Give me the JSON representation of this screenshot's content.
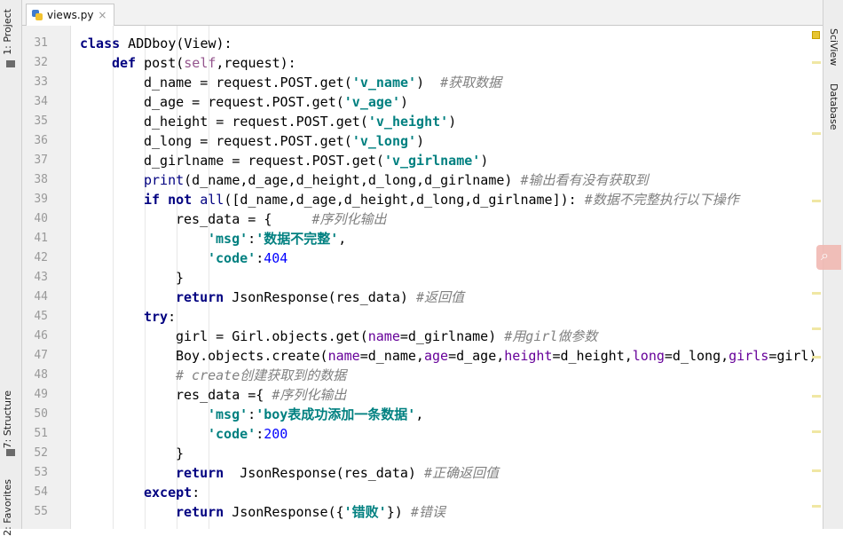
{
  "left_panel": {
    "project_tab": "1: Project",
    "structure_tab": "7: Structure",
    "favorites_tab": "2: Favorites"
  },
  "right_panel": {
    "sciview_tab": "SciView",
    "database_tab": "Database"
  },
  "editor_tab": {
    "filename": "views.py",
    "close_glyph": "×"
  },
  "line_numbers": [
    "31",
    "32",
    "33",
    "34",
    "35",
    "36",
    "37",
    "38",
    "39",
    "40",
    "41",
    "42",
    "43",
    "44",
    "45",
    "46",
    "47",
    "48",
    "49",
    "50",
    "51",
    "52",
    "53",
    "54",
    "55"
  ],
  "code": {
    "l31": {
      "kw": "class",
      "rest": " ADDboy(View):"
    },
    "l32": {
      "kw": "def",
      "a": " post(",
      "self": "self",
      "b": ",request):"
    },
    "l33": {
      "a": "d_name = request.POST.get(",
      "s": "'v_name'",
      "b": ")  ",
      "c": "#获取数据"
    },
    "l34": {
      "a": "d_age = request.POST.get(",
      "s": "'v_age'",
      "b": ")"
    },
    "l35": {
      "a": "d_height = request.POST.get(",
      "s": "'v_height'",
      "b": ")"
    },
    "l36": {
      "a": "d_long = request.POST.get(",
      "s": "'v_long'",
      "b": ")"
    },
    "l37": {
      "a": "d_girlname = request.POST.get(",
      "s": "'v_girlname'",
      "b": ")"
    },
    "l38": {
      "fn": "print",
      "a": "(d_name,d_age,d_height,d_long,d_girlname) ",
      "c": "#输出看有没有获取到"
    },
    "l39": {
      "kw1": "if",
      "kw2": "not",
      "fn": "all",
      "a": "([d_name,d_age,d_height,d_long,d_girlname]): ",
      "c": "#数据不完整执行以下操作"
    },
    "l40": {
      "a": "res_data = {     ",
      "c": "#序列化输出"
    },
    "l41": {
      "s1": "'msg'",
      "a": ":",
      "s2": "'数据不完整'",
      "b": ","
    },
    "l42": {
      "s1": "'code'",
      "a": ":",
      "n": "404"
    },
    "l43": {
      "a": "}"
    },
    "l44": {
      "kw": "return",
      "a": " JsonResponse(res_data) ",
      "c": "#返回值"
    },
    "l45": {
      "kw": "try",
      "a": ":"
    },
    "l46": {
      "a": "girl = Girl.objects.get(",
      "k": "name",
      "b": "=d_girlname) ",
      "c": "#用girl做参数"
    },
    "l47": {
      "a": "Boy.objects.create(",
      "k1": "name",
      "b": "=d_name,",
      "k2": "age",
      "c1": "=d_age,",
      "k3": "height",
      "d": "=d_height,",
      "k4": "long",
      "e": "=d_long,",
      "k5": "girls",
      "f": "=girl)"
    },
    "l48": {
      "c": "# create创建获取到的数据"
    },
    "l49": {
      "a": "res_data ={ ",
      "c": "#序列化输出"
    },
    "l50": {
      "s1": "'msg'",
      "a": ":",
      "s2": "'boy表成功添加一条数据'",
      "b": ","
    },
    "l51": {
      "s1": "'code'",
      "a": ":",
      "n": "200"
    },
    "l52": {
      "a": "}"
    },
    "l53": {
      "kw": "return",
      "a": "  JsonResponse(res_data) ",
      "c": "#正确返回值"
    },
    "l54": {
      "kw": "except",
      "a": ":"
    },
    "l55": {
      "kw": "return",
      "a": " JsonResponse({",
      "s": "'错败'",
      "b": "}) ",
      "c": "#错误"
    }
  },
  "colors": {
    "keyword": "#000080",
    "string": "#008080",
    "number": "#0000ff",
    "comment": "#808080",
    "self": "#94558d",
    "kwarg": "#660099",
    "gutter_bg": "#f0f0f0"
  }
}
